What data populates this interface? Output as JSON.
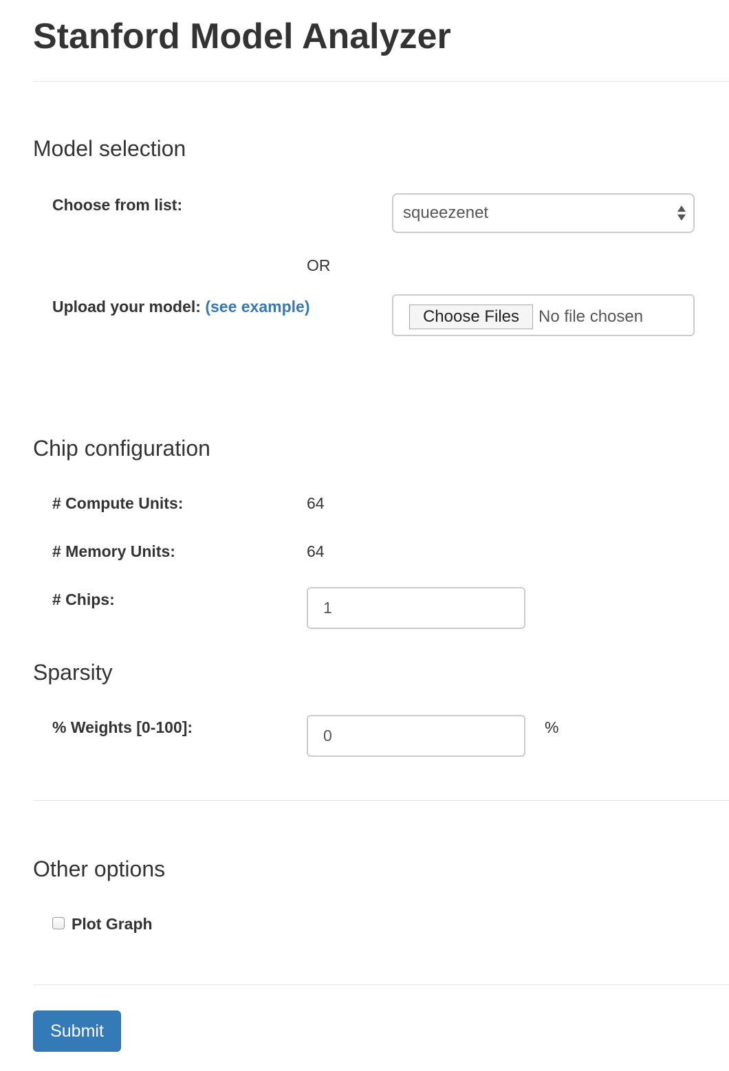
{
  "page": {
    "title": "Stanford Model Analyzer"
  },
  "model_selection": {
    "heading": "Model selection",
    "choose_label": "Choose from list:",
    "selected_model": "squeezenet",
    "or_text": "OR",
    "upload_label": "Upload your model:",
    "example_link": "(see example)",
    "file_button": "Choose Files",
    "file_status": "No file chosen"
  },
  "chip_configuration": {
    "heading": "Chip configuration",
    "compute_units_label": "# Compute Units:",
    "compute_units_value": "64",
    "memory_units_label": "# Memory Units:",
    "memory_units_value": "64",
    "chips_label": "# Chips:",
    "chips_value": "1"
  },
  "sparsity": {
    "heading": "Sparsity",
    "weights_label": "% Weights [0-100]:",
    "weights_value": "0",
    "unit": "%"
  },
  "other_options": {
    "heading": "Other options",
    "plot_graph_label": "Plot Graph",
    "plot_graph_checked": false
  },
  "submit_label": "Submit",
  "colors": {
    "link": "#337ab7",
    "primary_button": "#337ab7",
    "text": "#333333",
    "border": "#cccccc"
  }
}
